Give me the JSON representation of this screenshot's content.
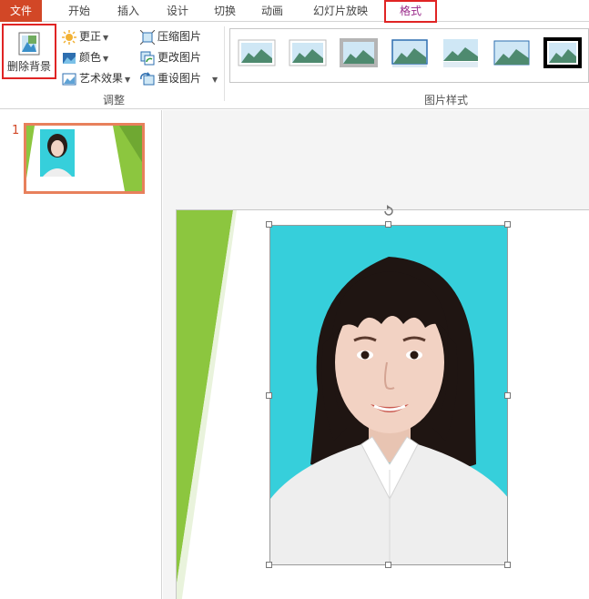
{
  "tabs": [
    {
      "label": "文件",
      "kind": "file"
    },
    {
      "label": "开始"
    },
    {
      "label": "插入"
    },
    {
      "label": "设计"
    },
    {
      "label": "切换"
    },
    {
      "label": "动画"
    },
    {
      "label": "幻灯片放映"
    },
    {
      "label": "格式",
      "kind": "active"
    }
  ],
  "ribbon": {
    "remove_bg": "删除背景",
    "corrections": "更正",
    "color": "颜色",
    "artistic": "艺术效果",
    "compress": "压缩图片",
    "change": "更改图片",
    "reset": "重设图片",
    "adjust_group": "调整",
    "styles_group": "图片样式"
  },
  "slides": {
    "number": "1"
  },
  "colors": {
    "file_tab": "#d24726",
    "photo_bg": "#36cfdb",
    "slide_accent": "#8cc63f",
    "highlight": "#e02424"
  }
}
